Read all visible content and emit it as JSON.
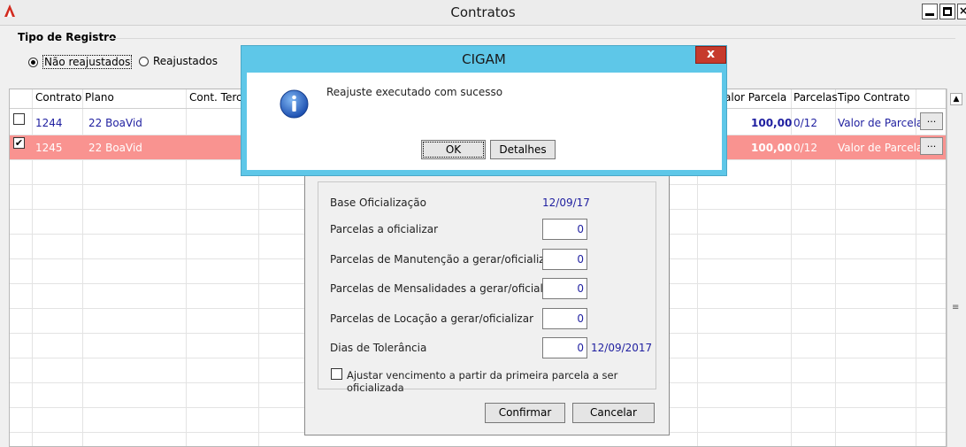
{
  "window": {
    "title": "Contratos"
  },
  "filter": {
    "group_title": "Tipo de Registro",
    "options": [
      {
        "label": "Não reajustados",
        "selected": true
      },
      {
        "label": "Reajustados",
        "selected": false
      }
    ]
  },
  "grid": {
    "headers": [
      "Contrato",
      "Plano",
      "Cont. Terce",
      "alor Parcela",
      "Parcelas",
      "Tipo Contrato"
    ],
    "rows": [
      {
        "checked": false,
        "contrato": "1244",
        "plano": "22 BoaVid",
        "valor": "100,00",
        "parcelas": "0/12",
        "tipo": "Valor de Parcela",
        "button": "..."
      },
      {
        "checked": true,
        "contrato": "1245",
        "plano": "22 BoaVid",
        "valor": "100,00",
        "parcelas": "0/12",
        "tipo": "Valor de Parcela",
        "button": "..."
      }
    ]
  },
  "panel": {
    "base_label": "Base Oficialização",
    "base_value": "12/09/17",
    "fields": [
      {
        "label": "Parcelas a oficializar",
        "value": "0"
      },
      {
        "label": "Parcelas de Manutenção a gerar/oficializar",
        "value": "0"
      },
      {
        "label": "Parcelas de Mensalidades a gerar/oficializar",
        "value": "0"
      },
      {
        "label": "Parcelas de Locação a gerar/oficializar",
        "value": "0"
      },
      {
        "label": "Dias de Tolerância",
        "value": "0",
        "date": "12/09/2017"
      }
    ],
    "checkbox_label": "Ajustar vencimento a partir da primeira parcela a ser oficializada",
    "confirm_label": "Confirmar",
    "cancel_label": "Cancelar"
  },
  "dialog": {
    "title": "CIGAM",
    "message": "Reajuste executado com sucesso",
    "ok_label": "OK",
    "details_label": "Detalhes",
    "close_label": "x"
  },
  "colors": {
    "selected_row": "#f99390",
    "dialog_frame": "#5ec7e8",
    "close_button": "#c63a2c",
    "link_blue": "#1f1fa0"
  }
}
